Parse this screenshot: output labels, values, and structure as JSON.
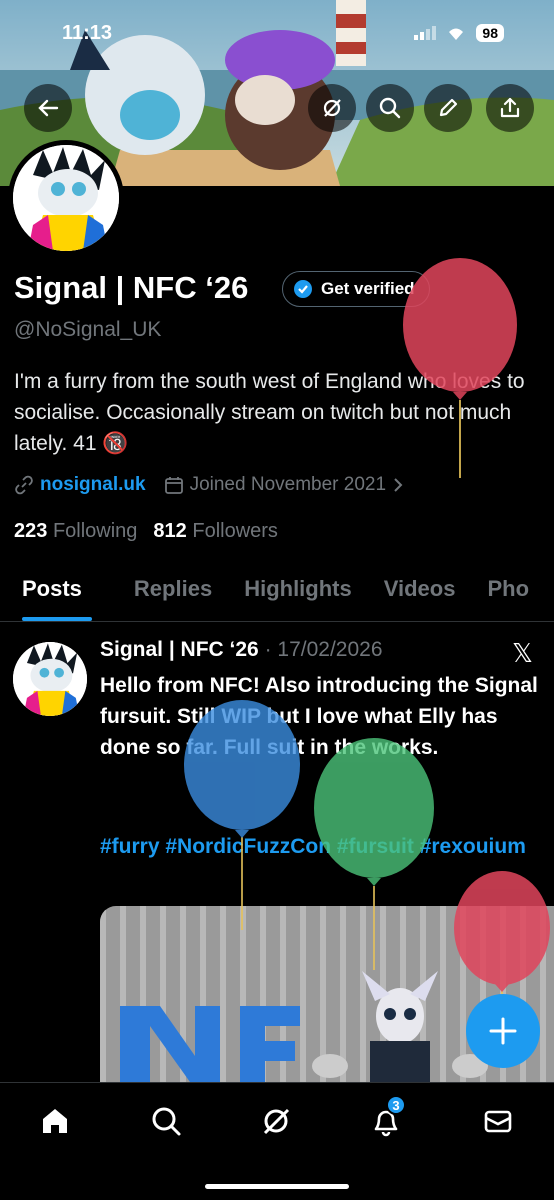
{
  "status": {
    "time": "11:13",
    "battery": "98"
  },
  "profile": {
    "name": "Signal | NFC ‘26",
    "verify_label": "Get verified",
    "handle": "@NoSignal_UK",
    "bio": "I'm a furry from the south west of England who loves to socialise. Occasionally stream on twitch but not much lately. 41 🔞",
    "link": "nosignal.uk",
    "joined": "Joined November 2021",
    "following_count": "223",
    "following_label": "Following",
    "followers_count": "812",
    "followers_label": "Followers"
  },
  "tabs": [
    "Posts",
    "Replies",
    "Highlights",
    "Videos",
    "Pho"
  ],
  "post": {
    "author": "Signal | NFC ‘26",
    "date": "· 17/02/2026",
    "text": "Hello from NFC!  Also introducing the Signal fursuit.  Still WIP but I love what Elly has done so far.  Full suit in the works.",
    "hashtags": "#furry #NordicFuzzCon #fursuit #rexouium"
  },
  "nav": {
    "notification_badge": "3"
  },
  "icons": [
    "back-arrow-icon",
    "grok-icon",
    "search-icon",
    "edit-icon",
    "share-icon",
    "verified-check-icon",
    "link-icon",
    "calendar-icon",
    "chevron-right-icon",
    "x-logo-icon",
    "plus-icon",
    "home-icon",
    "search-icon",
    "grok-icon",
    "bell-icon",
    "mail-icon"
  ],
  "colors": {
    "accent": "#1d9bf0",
    "background": "#000000",
    "muted": "#71767b"
  }
}
